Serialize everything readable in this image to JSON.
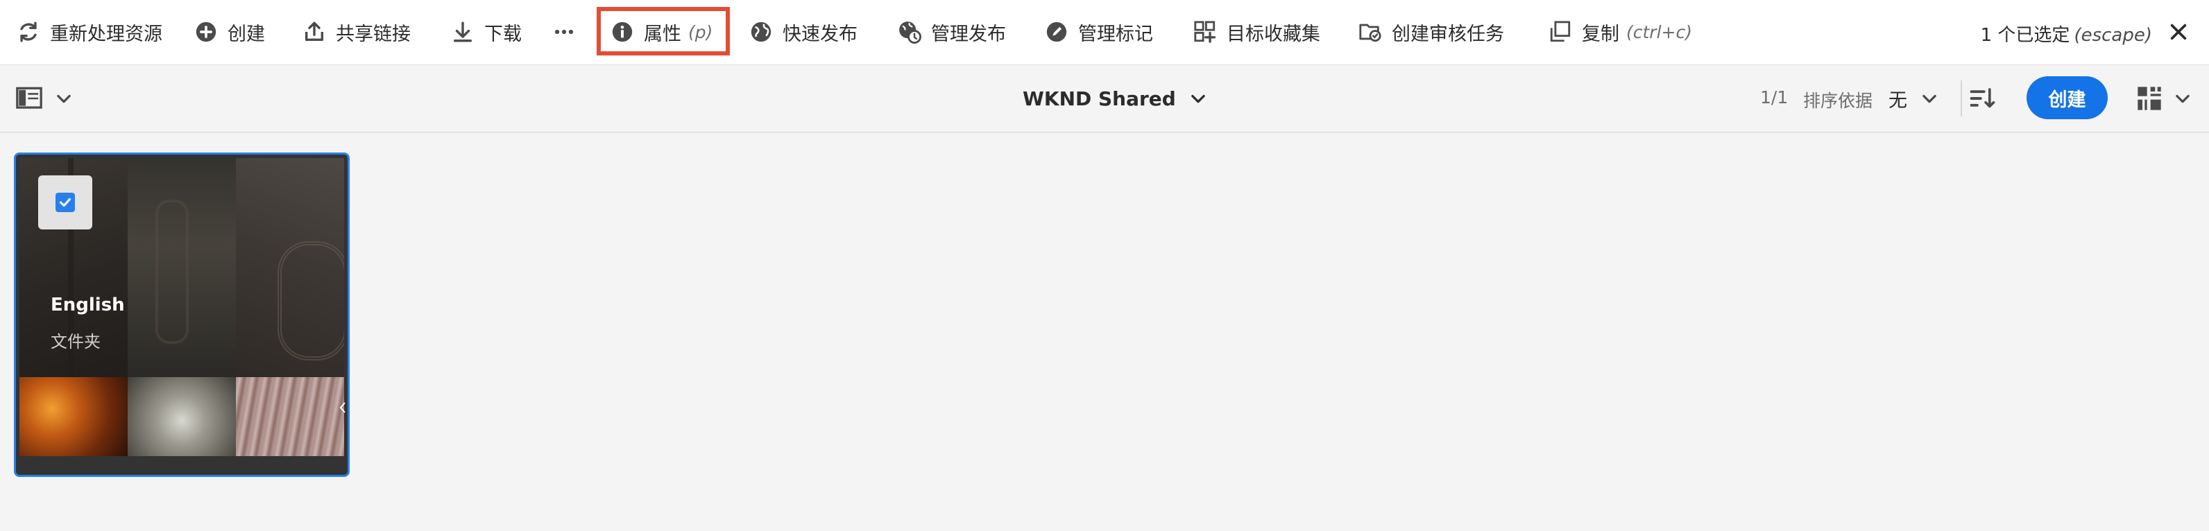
{
  "actionbar": {
    "items": [
      {
        "label": "重新处理资源",
        "icon": "refresh-icon"
      },
      {
        "label": "创建",
        "icon": "add-circle-icon"
      },
      {
        "label": "共享链接",
        "icon": "share-icon"
      },
      {
        "label": "下载",
        "icon": "download-icon"
      },
      {
        "label": "属性",
        "hint": "(p)",
        "icon": "info-icon"
      },
      {
        "label": "快速发布",
        "icon": "globe-icon"
      },
      {
        "label": "管理发布",
        "icon": "globe-clock-icon"
      },
      {
        "label": "管理标记",
        "icon": "pencil-icon"
      },
      {
        "label": "目标收藏集",
        "icon": "collection-add-icon"
      },
      {
        "label": "创建审核任务",
        "icon": "folder-review-icon"
      },
      {
        "label": "复制",
        "hint": "(ctrl+c)",
        "icon": "copy-icon"
      }
    ],
    "more_icon": "ellipsis-icon",
    "selection": {
      "text": "1 个已选定",
      "hint": "(escape)"
    },
    "close_icon": "close-icon",
    "highlight_color": "#e34d35"
  },
  "subbar": {
    "breadcrumb": "WKND Shared",
    "pager": "1/1",
    "sort_label": "排序依据",
    "sort_value": "无",
    "create_label": "创建",
    "accent": "#1473e6"
  },
  "card": {
    "title": "English",
    "subtitle": "文件夹",
    "selected": true,
    "selection_color": "#2680eb"
  }
}
